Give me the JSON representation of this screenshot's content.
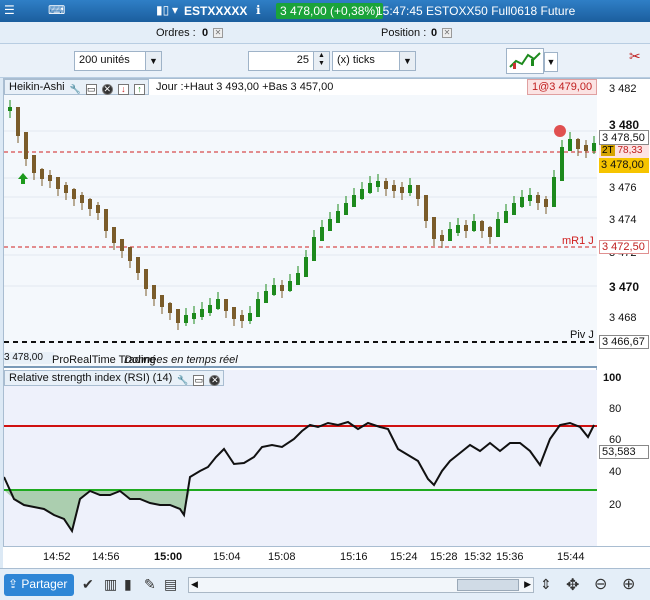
{
  "topbar": {
    "instrument": "ESTXXXXX",
    "price_change": "3 478,00 (+0,38%)",
    "time_title": "15:47:45 ESTOXX50 Full0618 Future"
  },
  "orderbar": {
    "orders_label": "Ordres :",
    "orders_value": "0",
    "position_label": "Position :",
    "position_value": "0"
  },
  "toolbar": {
    "units": "200 unités",
    "ticks_value": "25",
    "ticks_unit": "(x) ticks"
  },
  "price_panel": {
    "title": "Heikin-Ashi",
    "info": "Jour :+Haut 3 493,00 +Bas 3 457,00",
    "top_badge": "1@3 479,00",
    "level_current": "3 478,50",
    "level_2t": "2T",
    "level_2t_value": "78,33",
    "level_last": "3 478,00",
    "level_mr1": "3 472,50",
    "level_piv": "3 466,67",
    "label_mr1": "mR1 J",
    "label_piv": "Piv J",
    "source": "ProRealTime Trading",
    "realtime": "Données en temps réel",
    "overlay_left": "3 478,00",
    "yticks": [
      "3 482",
      "3 480",
      "3 478",
      "3 476",
      "3 474",
      "3 472",
      "3 470",
      "3 468"
    ]
  },
  "rsi_panel": {
    "title": "Relative strength index (RSI) (14)",
    "value": "53,583",
    "yticks": [
      "100",
      "80",
      "60",
      "40",
      "20"
    ]
  },
  "xaxis": {
    "labels": [
      "14:52",
      "14:56",
      "15:00",
      "15:04",
      "15:08",
      "15:16",
      "15:24",
      "15:28",
      "15:32",
      "15:36",
      "15:44"
    ]
  },
  "bottombar": {
    "share": "Partager"
  },
  "colors": {
    "up": "#1d8a1d",
    "down": "#7a5c2a",
    "resistance": "#d01010",
    "support": "#1faa1f"
  }
}
